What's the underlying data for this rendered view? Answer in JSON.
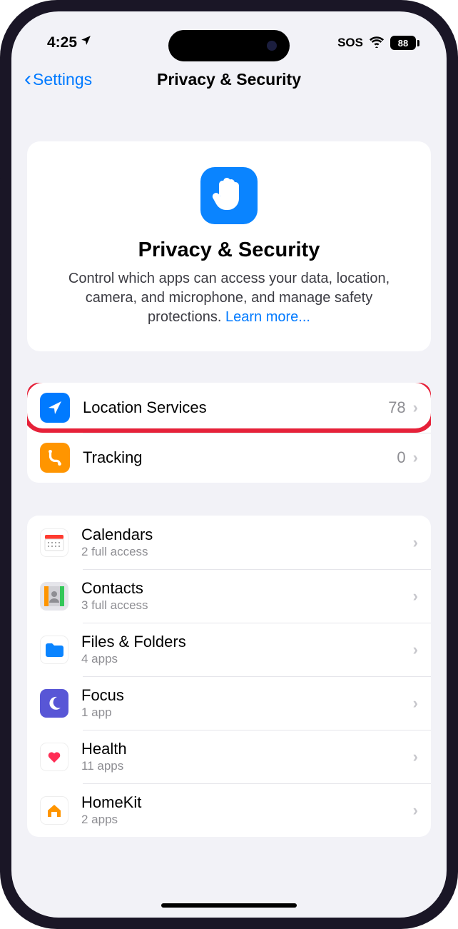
{
  "status": {
    "time": "4:25",
    "sos": "SOS",
    "battery": "88"
  },
  "nav": {
    "back": "Settings",
    "title": "Privacy & Security"
  },
  "hero": {
    "title": "Privacy & Security",
    "desc": "Control which apps can access your data, location, camera, and microphone, and manage safety protections. ",
    "link": "Learn more..."
  },
  "group1": [
    {
      "label": "Location Services",
      "value": "78",
      "icon": "location"
    },
    {
      "label": "Tracking",
      "value": "0",
      "icon": "tracking"
    }
  ],
  "group2": [
    {
      "label": "Calendars",
      "sub": "2 full access",
      "icon": "calendar"
    },
    {
      "label": "Contacts",
      "sub": "3 full access",
      "icon": "contacts"
    },
    {
      "label": "Files & Folders",
      "sub": "4 apps",
      "icon": "files"
    },
    {
      "label": "Focus",
      "sub": "1 app",
      "icon": "focus"
    },
    {
      "label": "Health",
      "sub": "11 apps",
      "icon": "health"
    },
    {
      "label": "HomeKit",
      "sub": "2 apps",
      "icon": "homekit"
    }
  ],
  "highlight": {
    "row": "location-services"
  }
}
